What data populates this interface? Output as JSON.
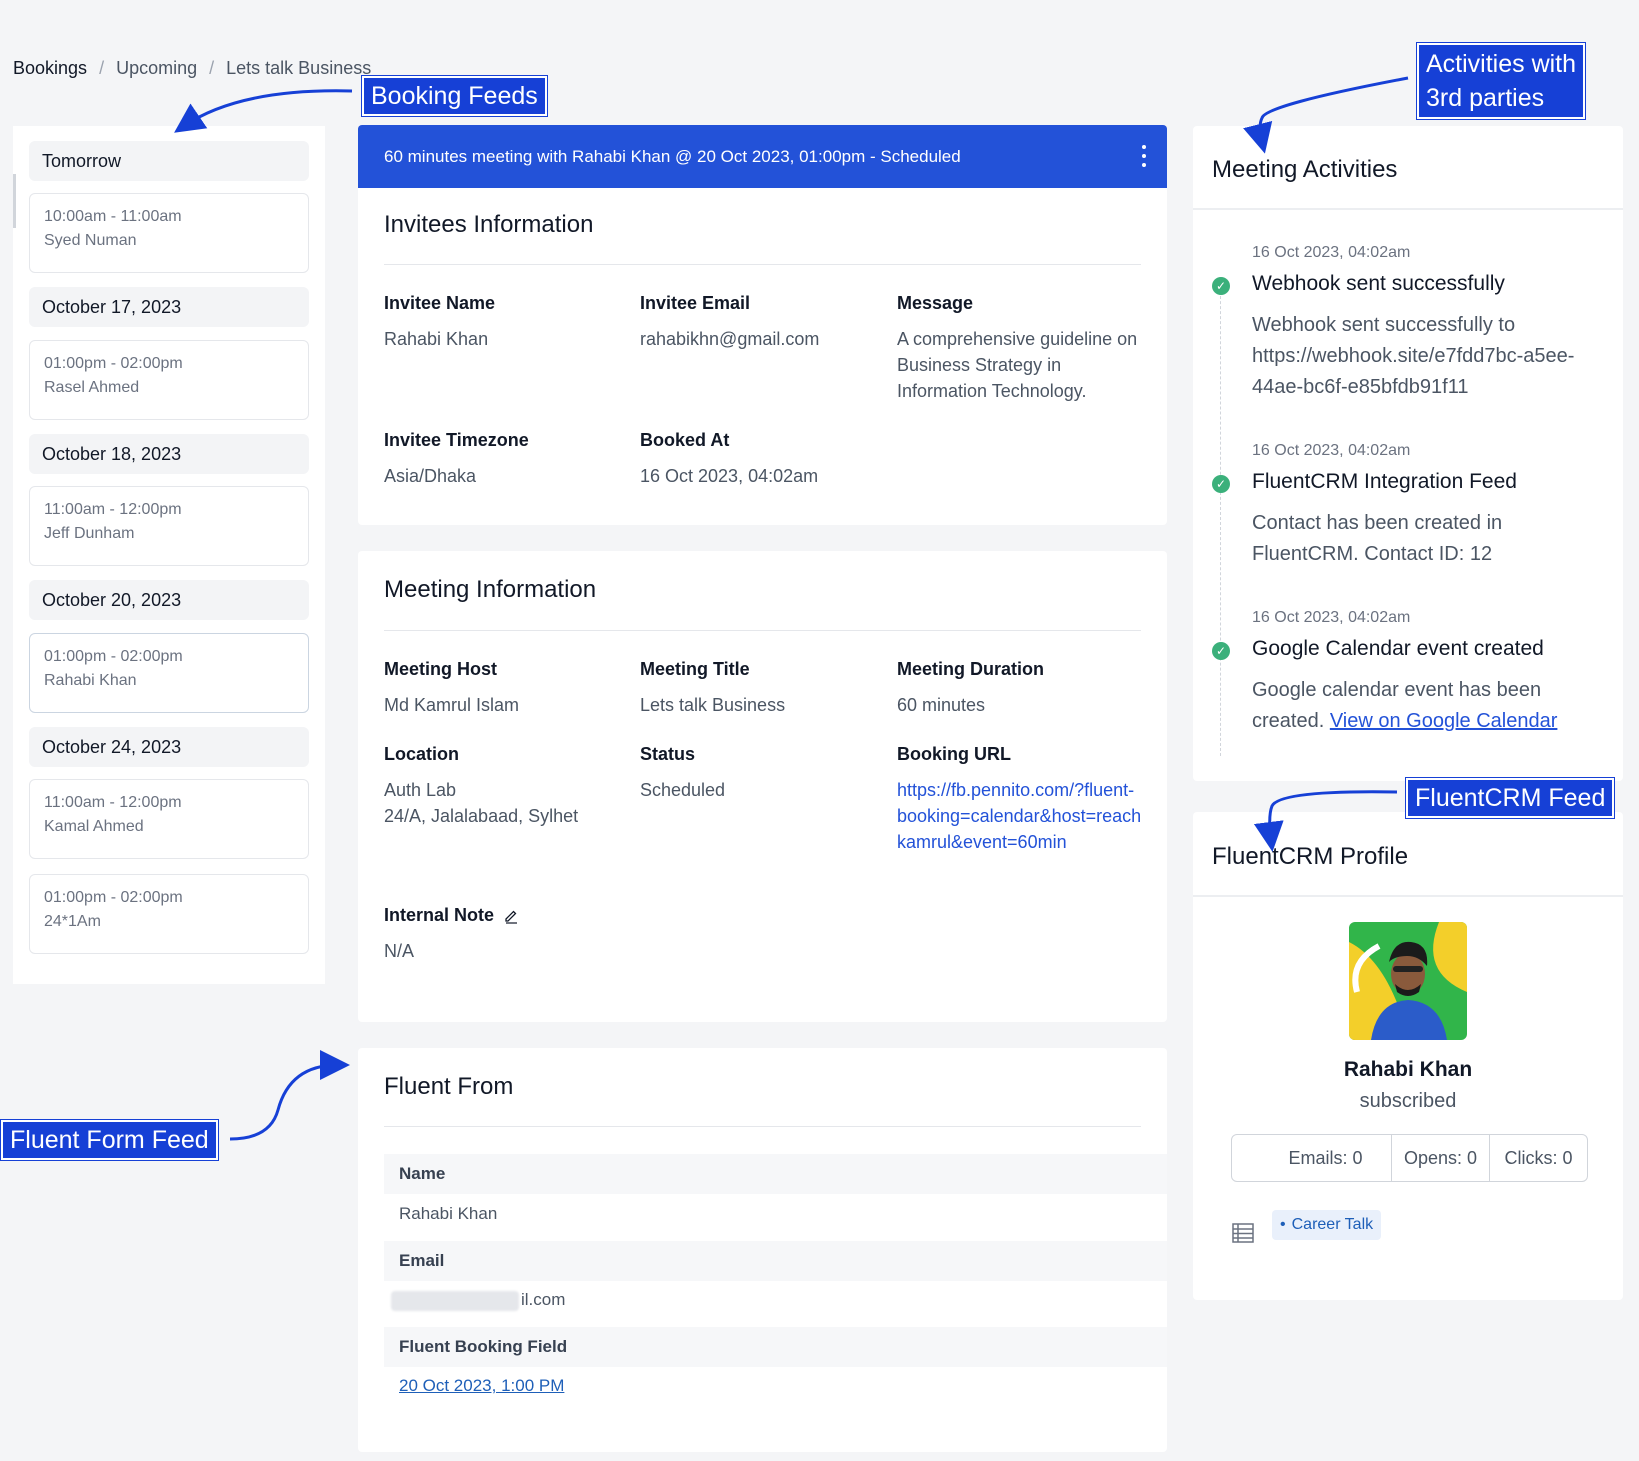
{
  "breadcrumb": {
    "items": [
      "Bookings",
      "Upcoming",
      "Lets talk Business"
    ],
    "separator": "/"
  },
  "annotations": {
    "booking_feeds": "Booking Feeds",
    "activities_line1": "Activities with",
    "activities_line2": "3rd parties",
    "fluentcrm_feed": "FluentCRM Feed",
    "fluent_form_feed": "Fluent Form Feed"
  },
  "feed": {
    "groups": [
      {
        "date": "Tomorrow",
        "items": [
          {
            "time": "10:00am - 11:00am",
            "name": "Syed Numan"
          }
        ]
      },
      {
        "date": "October 17, 2023",
        "items": [
          {
            "time": "01:00pm - 02:00pm",
            "name": "Rasel Ahmed"
          }
        ]
      },
      {
        "date": "October 18, 2023",
        "items": [
          {
            "time": "11:00am - 12:00pm",
            "name": "Jeff Dunham"
          }
        ]
      },
      {
        "date": "October 20, 2023",
        "items": [
          {
            "time": "01:00pm - 02:00pm",
            "name": "Rahabi Khan"
          }
        ]
      },
      {
        "date": "October 24, 2023",
        "items": [
          {
            "time": "11:00am - 12:00pm",
            "name": "Kamal Ahmed"
          },
          {
            "time": "01:00pm - 02:00pm",
            "name": "24*1Am"
          }
        ]
      }
    ]
  },
  "booking": {
    "header": "60 minutes meeting with Rahabi Khan @ 20 Oct 2023, 01:00pm - Scheduled",
    "colors": {
      "accent": "#2352d8",
      "success": "#3bb07b"
    }
  },
  "invitee": {
    "title": "Invitees Information",
    "name_label": "Invitee Name",
    "name": "Rahabi Khan",
    "email_label": "Invitee Email",
    "email": "rahabikhn@gmail.com",
    "message_label": "Message",
    "message": "A comprehensive guideline on Business Strategy in Information Technology.",
    "timezone_label": "Invitee Timezone",
    "timezone": "Asia/Dhaka",
    "booked_label": "Booked At",
    "booked": "16 Oct 2023, 04:02am"
  },
  "meeting": {
    "title": "Meeting Information",
    "host_label": "Meeting Host",
    "host": "Md Kamrul Islam",
    "mtitle_label": "Meeting Title",
    "mtitle": "Lets talk Business",
    "duration_label": "Meeting Duration",
    "duration": "60 minutes",
    "location_label": "Location",
    "location_line1": "Auth Lab",
    "location_line2": "24/A, Jalalabaad, Sylhet",
    "status_label": "Status",
    "status": "Scheduled",
    "url_label": "Booking URL",
    "url": "https://fb.pennito.com/?fluent-booking=calendar&host=reachkamrul&event=60min",
    "note_label": "Internal Note",
    "note": "N/A"
  },
  "fluent_form": {
    "title": "Fluent From",
    "name_label": "Name",
    "name": "Rahabi Khan",
    "email_label": "Email",
    "email_visible": "il.com",
    "field_label": "Fluent Booking Field",
    "field_value": "20 Oct 2023, 1:00 PM"
  },
  "activities": {
    "title": "Meeting Activities",
    "items": [
      {
        "time": "16 Oct 2023, 04:02am",
        "title": "Webhook sent successfully",
        "body": "Webhook sent successfully to https://webhook.site/e7fdd7bc-a5ee-44ae-bc6f-e85bfdb91f11"
      },
      {
        "time": "16 Oct 2023, 04:02am",
        "title": "FluentCRM Integration Feed",
        "body": "Contact has been created in FluentCRM. Contact ID: 12"
      },
      {
        "time": "16 Oct 2023, 04:02am",
        "title": "Google Calendar event created",
        "body": "Google calendar event has been created.",
        "link": "View on Google Calendar"
      }
    ]
  },
  "crm": {
    "title": "FluentCRM Profile",
    "name": "Rahabi Khan",
    "status": "subscribed",
    "stats": [
      "Emails: 0",
      "Opens: 0",
      "Clicks: 0"
    ],
    "list_icon": "list-icon",
    "tag": "Career Talk"
  }
}
